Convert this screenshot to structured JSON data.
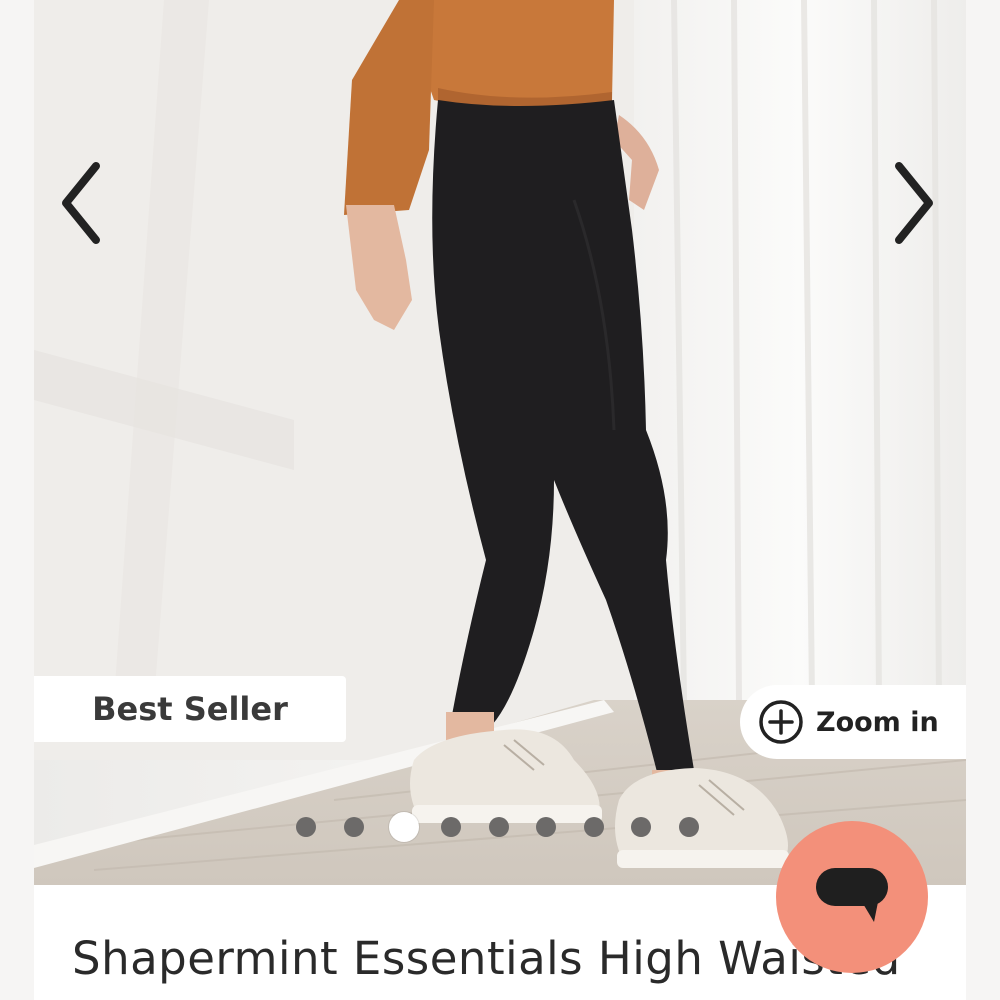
{
  "gallery": {
    "prev_icon": "chevron-left-icon",
    "next_icon": "chevron-right-icon",
    "badge_label": "Best Seller",
    "zoom_label": "Zoom in",
    "zoom_icon": "plus-circle-icon",
    "dot_count": 9,
    "active_dot_index": 2
  },
  "product": {
    "title": "Shapermint Essentials High Waisted"
  },
  "chat": {
    "icon": "chat-bubble-icon",
    "color": "#f3907a"
  },
  "colors": {
    "badge_bg": "#ffffff",
    "dot_inactive": "#6c6a69",
    "dot_active": "#ffffff",
    "leggings": "#1f1e20",
    "sweater": "#c8783a"
  }
}
